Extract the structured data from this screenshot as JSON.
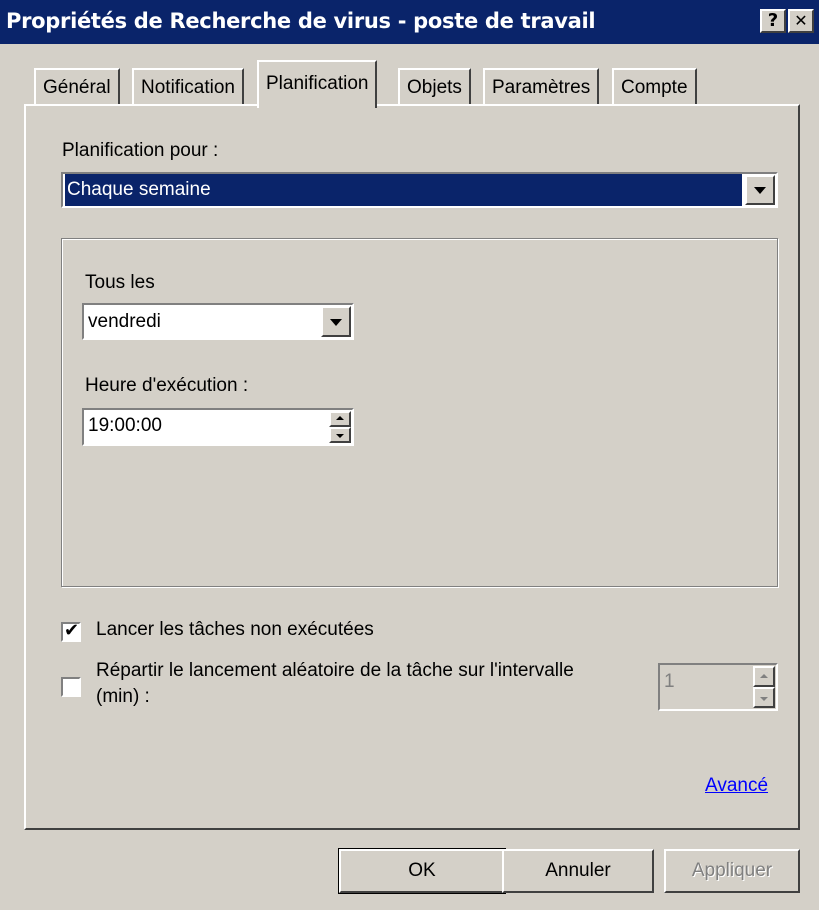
{
  "window": {
    "title": "Propriétés de Recherche de virus - poste de travail",
    "help_label": "?",
    "close_label": "✕"
  },
  "tabs": [
    {
      "label": "Général",
      "active": false
    },
    {
      "label": "Notification",
      "active": false
    },
    {
      "label": "Planification",
      "active": true
    },
    {
      "label": "Objets",
      "active": false
    },
    {
      "label": "Paramètres",
      "active": false
    },
    {
      "label": "Compte",
      "active": false
    }
  ],
  "schedule": {
    "label": "Planification pour :",
    "value": "Chaque semaine"
  },
  "weekly": {
    "every_label": "Tous les",
    "day_value": "vendredi",
    "time_label": "Heure d'exécution :",
    "time_value": "19:00:00"
  },
  "options": {
    "run_missed_label": "Lancer les tâches non exécutées",
    "run_missed_checked": true,
    "random_line1": "Répartir le lancement aléatoire de la tâche sur l'intervalle",
    "random_line2": "(min) :",
    "random_checked": false,
    "random_value": "1"
  },
  "advanced_link": "Avancé",
  "buttons": {
    "ok": "OK",
    "cancel": "Annuler",
    "apply": "Appliquer"
  },
  "colors": {
    "titlebar": "#0a246a",
    "face": "#d4d0c8",
    "selection": "#0a246a",
    "link": "#0000ff"
  }
}
